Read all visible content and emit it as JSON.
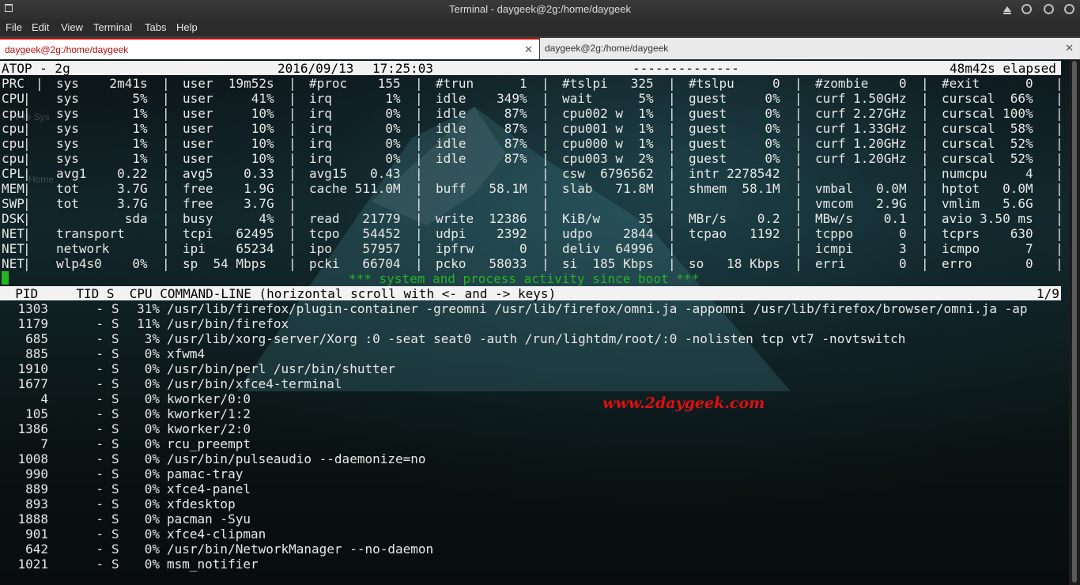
{
  "window": {
    "title": "Terminal - daygeek@2g:/home/daygeek"
  },
  "menu": [
    "File",
    "Edit",
    "View",
    "Terminal",
    "Tabs",
    "Help"
  ],
  "tabs": [
    {
      "label": "daygeek@2g:/home/daygeek",
      "active": true
    },
    {
      "label": "daygeek@2g:/home/daygeek",
      "active": false
    }
  ],
  "desktop_ghost": {
    "filesys": "File Sys",
    "home": "Home"
  },
  "atop": {
    "header": {
      "name": "ATOP - 2g",
      "date": "2016/09/13",
      "time": "17:25:03",
      "dashes": "--------------",
      "elapsed": "48m42s elapsed"
    },
    "rows": [
      [
        "PRC",
        "sys    2m41s",
        "user  19m52s",
        "#proc    155",
        "#trun      1",
        "#tslpi   325",
        "#tslpu     0",
        "#zombie    0",
        "#exit      0"
      ],
      [
        "CPU",
        "sys       5%",
        "user     41%",
        "irq       1%",
        "idle    349%",
        "wait      5%",
        "guest     0%",
        "curf 1.50GHz",
        "curscal  66%"
      ],
      [
        "cpu",
        "sys       1%",
        "user     10%",
        "irq       0%",
        "idle     87%",
        "cpu002 w  1%",
        "guest     0%",
        "curf 2.27GHz",
        "curscal 100%"
      ],
      [
        "cpu",
        "sys       1%",
        "user     10%",
        "irq       0%",
        "idle     87%",
        "cpu001 w  1%",
        "guest     0%",
        "curf 1.33GHz",
        "curscal  58%"
      ],
      [
        "cpu",
        "sys       1%",
        "user     10%",
        "irq       0%",
        "idle     87%",
        "cpu000 w  1%",
        "guest     0%",
        "curf 1.20GHz",
        "curscal  52%"
      ],
      [
        "cpu",
        "sys       1%",
        "user     10%",
        "irq       0%",
        "idle     87%",
        "cpu003 w  2%",
        "guest     0%",
        "curf 1.20GHz",
        "curscal  52%"
      ],
      [
        "CPL",
        "avg1    0.22",
        "avg5    0.33",
        "avg15   0.43",
        "",
        "csw  6796562",
        "intr 2278542",
        "",
        "numcpu     4"
      ],
      [
        "MEM",
        "tot     3.7G",
        "free    1.9G",
        "cache 511.0M",
        "buff   58.1M",
        "slab   71.8M",
        "shmem  58.1M",
        "vmbal   0.0M",
        "hptot   0.0M"
      ],
      [
        "SWP",
        "tot     3.7G",
        "free    3.7G",
        "",
        "",
        "",
        "",
        "vmcom   2.9G",
        "vmlim   5.6G"
      ],
      [
        "DSK",
        "         sda",
        "busy      4%",
        "read   21779",
        "write  12386",
        "KiB/w     35",
        "MBr/s    0.2",
        "MBw/s    0.1",
        "avio 3.50 ms"
      ],
      [
        "NET",
        "transport   ",
        "tcpi   62495",
        "tcpo   54452",
        "udpi    2392",
        "udpo    2844",
        "tcpao   1192",
        "tcppo      0",
        "tcprs    630"
      ],
      [
        "NET",
        "network     ",
        "ipi    65234",
        "ipo    57957",
        "ipfrw      0",
        "deliv  64996",
        "",
        "icmpi      3",
        "icmpo      7"
      ],
      [
        "NET",
        "wlp4s0    0%",
        "sp  54 Mbps",
        "pcki   66704",
        "pcko   58033",
        "si  185 Kbps",
        "so   18 Kbps",
        "erri       0",
        "erro       0"
      ]
    ],
    "notice": "*** system and process activity since boot ***",
    "proc_header": {
      "cols": "  PID     TID S  CPU COMMAND-LINE (horizontal scroll with <- and -> keys)",
      "page": "1/9"
    },
    "processes": [
      {
        "pid": "1303",
        "tid": "-",
        "s": "S",
        "cpu": "31%",
        "cmd": "/usr/lib/firefox/plugin-container -greomni /usr/lib/firefox/omni.ja -appomni /usr/lib/firefox/browser/omni.ja -ap"
      },
      {
        "pid": "1179",
        "tid": "-",
        "s": "S",
        "cpu": "11%",
        "cmd": "/usr/bin/firefox"
      },
      {
        "pid": "685",
        "tid": "-",
        "s": "S",
        "cpu": "3%",
        "cmd": "/usr/lib/xorg-server/Xorg :0 -seat seat0 -auth /run/lightdm/root/:0 -nolisten tcp vt7 -novtswitch"
      },
      {
        "pid": "885",
        "tid": "-",
        "s": "S",
        "cpu": "0%",
        "cmd": "xfwm4"
      },
      {
        "pid": "1910",
        "tid": "-",
        "s": "S",
        "cpu": "0%",
        "cmd": "/usr/bin/perl /usr/bin/shutter"
      },
      {
        "pid": "1677",
        "tid": "-",
        "s": "S",
        "cpu": "0%",
        "cmd": "/usr/bin/xfce4-terminal"
      },
      {
        "pid": "4",
        "tid": "-",
        "s": "S",
        "cpu": "0%",
        "cmd": "kworker/0:0"
      },
      {
        "pid": "105",
        "tid": "-",
        "s": "S",
        "cpu": "0%",
        "cmd": "kworker/1:2"
      },
      {
        "pid": "1386",
        "tid": "-",
        "s": "S",
        "cpu": "0%",
        "cmd": "kworker/2:0"
      },
      {
        "pid": "7",
        "tid": "-",
        "s": "S",
        "cpu": "0%",
        "cmd": "rcu_preempt"
      },
      {
        "pid": "1008",
        "tid": "-",
        "s": "S",
        "cpu": "0%",
        "cmd": "/usr/bin/pulseaudio --daemonize=no"
      },
      {
        "pid": "990",
        "tid": "-",
        "s": "S",
        "cpu": "0%",
        "cmd": "pamac-tray"
      },
      {
        "pid": "889",
        "tid": "-",
        "s": "S",
        "cpu": "0%",
        "cmd": "xfce4-panel"
      },
      {
        "pid": "893",
        "tid": "-",
        "s": "S",
        "cpu": "0%",
        "cmd": "xfdesktop"
      },
      {
        "pid": "1888",
        "tid": "-",
        "s": "S",
        "cpu": "0%",
        "cmd": "pacman -Syu"
      },
      {
        "pid": "901",
        "tid": "-",
        "s": "S",
        "cpu": "0%",
        "cmd": "xfce4-clipman"
      },
      {
        "pid": "642",
        "tid": "-",
        "s": "S",
        "cpu": "0%",
        "cmd": "/usr/bin/NetworkManager --no-daemon"
      },
      {
        "pid": "1021",
        "tid": "-",
        "s": "S",
        "cpu": "0%",
        "cmd": "msm_notifier"
      }
    ]
  },
  "watermark": "www.2daygeek.com",
  "colors": {
    "active_tab_text": "#b01010",
    "notice": "#25b325",
    "watermark": "#e01010"
  }
}
